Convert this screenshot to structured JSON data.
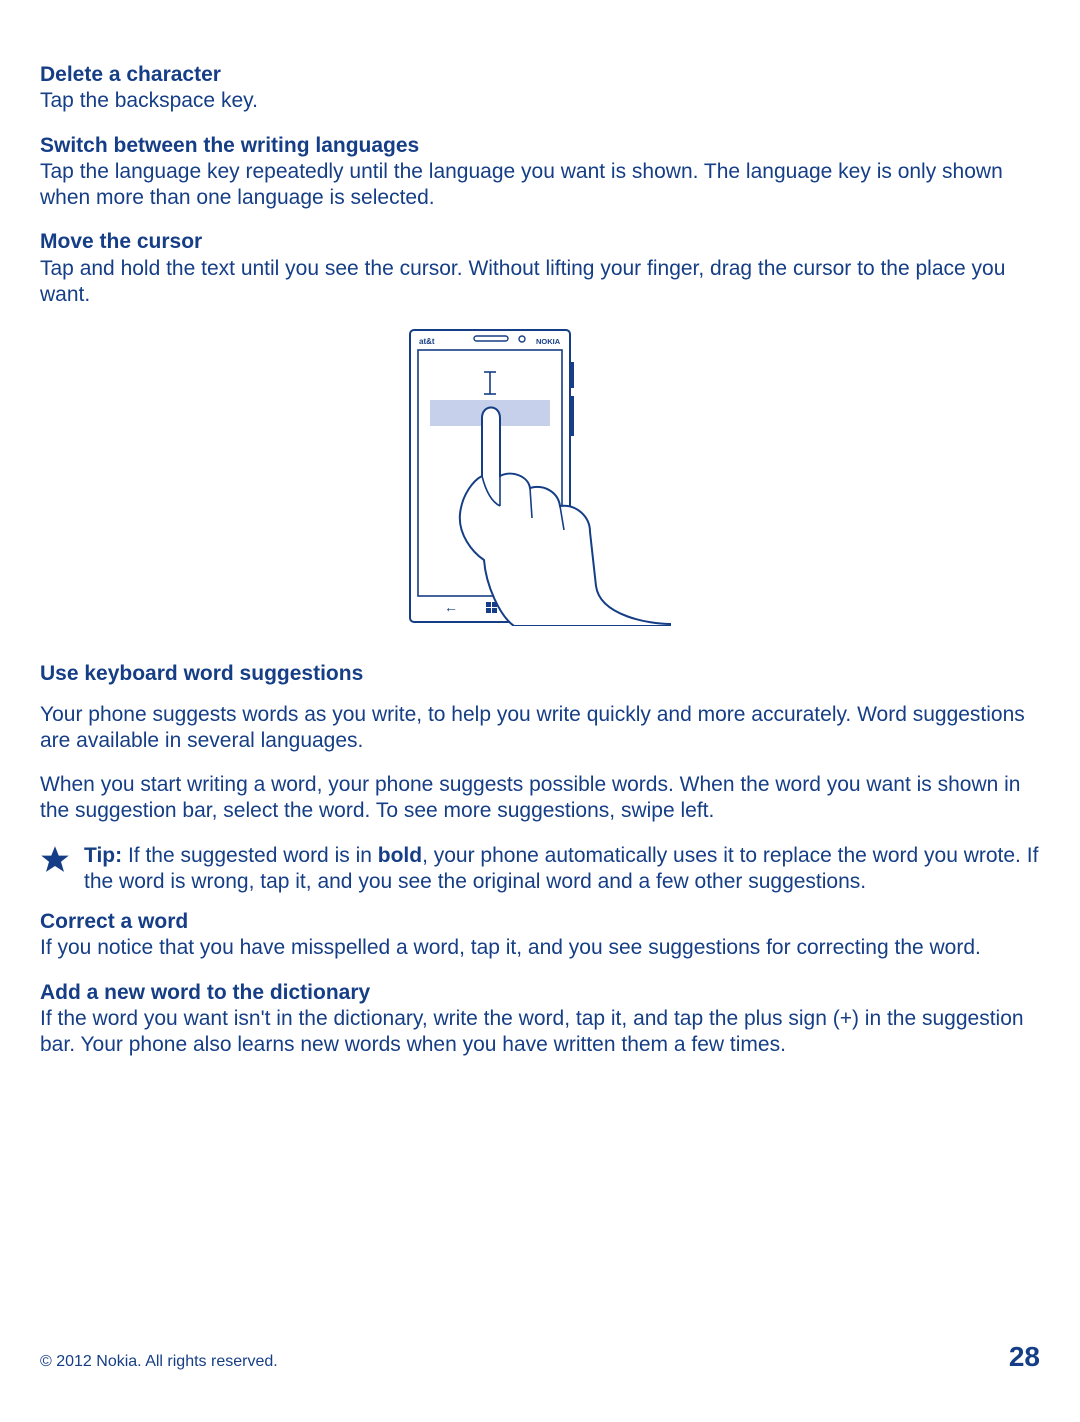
{
  "sections": {
    "delete_char": {
      "heading": "Delete a character",
      "body": "Tap the backspace key."
    },
    "switch_lang": {
      "heading": "Switch between the writing languages",
      "body": "Tap the language key repeatedly until the language you want is shown. The language key is only shown when more than one language is selected."
    },
    "move_cursor": {
      "heading": "Move the cursor",
      "body": "Tap and hold the text until you see the cursor. Without lifting your finger, drag the cursor to the place you want."
    },
    "word_suggest": {
      "heading": "Use keyboard word suggestions",
      "para1": "Your phone suggests words as you write, to help you write quickly and more accurately. Word suggestions are available in several languages.",
      "para2": "When you start writing a word, your phone suggests possible words. When the word you want is shown in the suggestion bar, select the word. To see more suggestions, swipe left."
    },
    "tip": {
      "label": "Tip:",
      "before_bold": " If the suggested word is in ",
      "bold_word": "bold",
      "after_bold": ", your phone automatically uses it to replace the word you wrote. If the word is wrong, tap it, and you see the original word and a few other suggestions."
    },
    "correct_word": {
      "heading": "Correct a word",
      "body": "If you notice that you have misspelled a word, tap it, and you see suggestions for correcting the word."
    },
    "add_word": {
      "heading": "Add a new word to the dictionary",
      "body": "If the word you want isn't in the dictionary, write the word, tap it, and tap the plus sign (+) in the suggestion bar. Your phone also learns new words when you have written them a few times."
    }
  },
  "phone_labels": {
    "carrier": "at&t",
    "brand": "NOKIA"
  },
  "footer": {
    "copyright": "© 2012 Nokia. All rights reserved.",
    "page_number": "28"
  }
}
